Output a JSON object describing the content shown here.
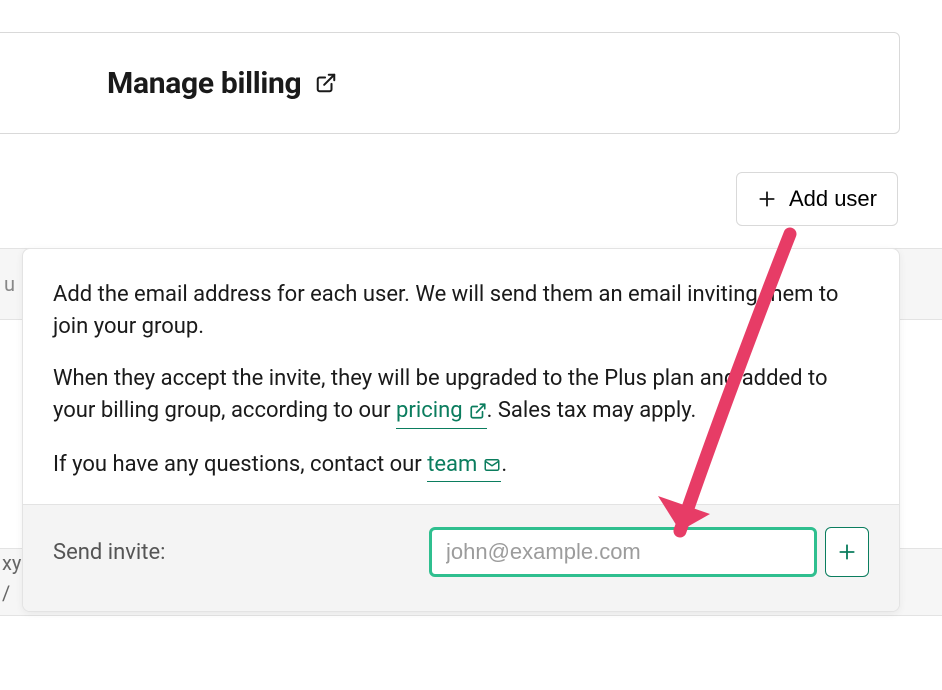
{
  "header": {
    "title": "Manage billing"
  },
  "actions": {
    "add_user_label": "Add user"
  },
  "background_rows": {
    "row1_fragment": "u",
    "row2_line1": "xy",
    "row2_line2": "/"
  },
  "panel": {
    "p1": "Add the email address for each user. We will send them an email inviting them to join your group.",
    "p2_before": "When they accept the invite, they will be upgraded to the Plus plan and added to your billing group, according to our ",
    "p2_link": "pricing",
    "p2_after": ". Sales tax may apply.",
    "p3_before": "If you have any questions, contact our ",
    "p3_link": "team",
    "p3_after": "."
  },
  "footer": {
    "label": "Send invite:",
    "placeholder": "john@example.com"
  },
  "colors": {
    "link": "#0b7d5e",
    "focus": "#2fbf8f",
    "arrow": "#e73c66"
  }
}
